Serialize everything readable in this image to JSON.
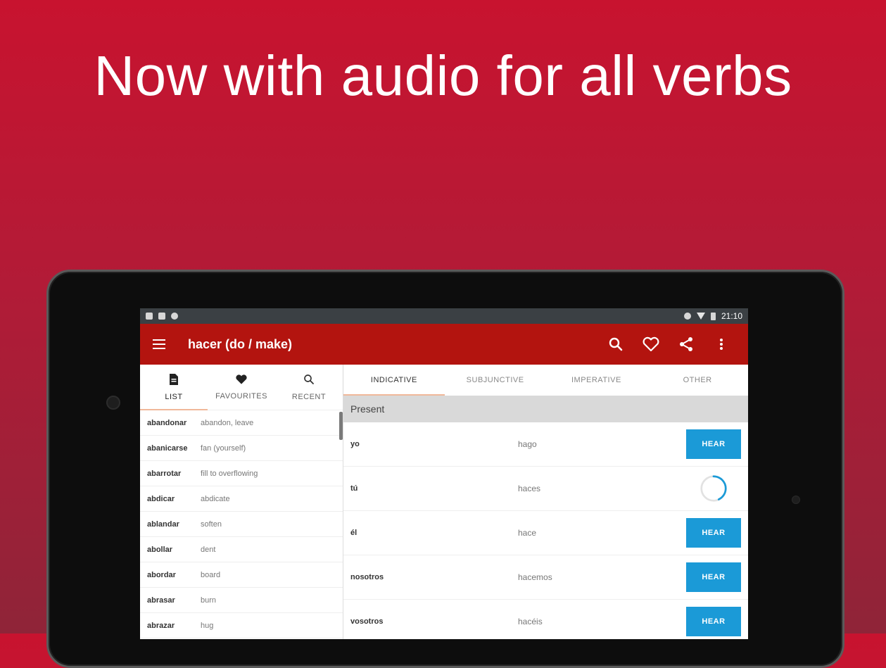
{
  "headline": "Now with audio for all verbs",
  "status_bar": {
    "time": "21:10"
  },
  "app_bar": {
    "title": "hacer (do / make)",
    "actions": [
      "search-icon",
      "heart-icon",
      "share-icon",
      "more-vert-icon"
    ]
  },
  "left_tabs": [
    {
      "label": "LIST",
      "icon": "document-icon",
      "active": true
    },
    {
      "label": "FAVOURITES",
      "icon": "heart-icon",
      "active": false
    },
    {
      "label": "RECENT",
      "icon": "search-recent-icon",
      "active": false
    }
  ],
  "verbs": [
    {
      "verb": "abandonar",
      "translation": "abandon, leave"
    },
    {
      "verb": "abanicarse",
      "translation": "fan (yourself)"
    },
    {
      "verb": "abarrotar",
      "translation": "fill to overflowing"
    },
    {
      "verb": "abdicar",
      "translation": "abdicate"
    },
    {
      "verb": "ablandar",
      "translation": "soften"
    },
    {
      "verb": "abollar",
      "translation": "dent"
    },
    {
      "verb": "abordar",
      "translation": "board"
    },
    {
      "verb": "abrasar",
      "translation": "burn"
    },
    {
      "verb": "abrazar",
      "translation": "hug"
    }
  ],
  "mood_tabs": [
    {
      "label": "INDICATIVE",
      "active": true
    },
    {
      "label": "SUBJUNCTIVE",
      "active": false
    },
    {
      "label": "IMPERATIVE",
      "active": false
    },
    {
      "label": "OTHER",
      "active": false
    }
  ],
  "section": {
    "title": "Present"
  },
  "conjugations": [
    {
      "pronoun": "yo",
      "form": "hago",
      "state": "button"
    },
    {
      "pronoun": "tú",
      "form": "haces",
      "state": "loading"
    },
    {
      "pronoun": "él",
      "form": "hace",
      "state": "button"
    },
    {
      "pronoun": "nosotros",
      "form": "hacemos",
      "state": "button"
    },
    {
      "pronoun": "vosotros",
      "form": "hacéis",
      "state": "button"
    }
  ],
  "hear_label": "HEAR",
  "colors": {
    "brand_red": "#b3140f",
    "hear_blue": "#1b9ad7",
    "status_bar": "#3b4044"
  }
}
